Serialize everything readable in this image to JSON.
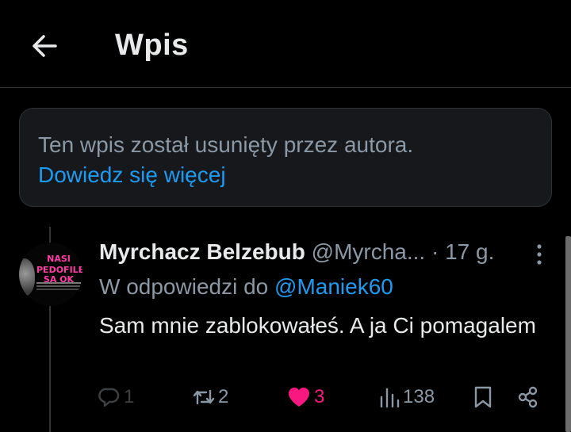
{
  "header": {
    "title": "Wpis",
    "back_icon": "arrow-left-icon"
  },
  "deleted_notice": {
    "text": "Ten wpis został usunięty przez autora.",
    "link": "Dowiedz się więcej"
  },
  "post": {
    "avatar_text_line1": "NASI",
    "avatar_text_line2": "PEDOFILE SĄ OK",
    "author_name": "Myrchacz Belzebub",
    "handle": "@Myrcha...",
    "time": "· 17 g.",
    "reply_prefix": "W odpowiedzi do ",
    "reply_to": "@Maniek60",
    "text": "Sam mnie zablokowałeś. A ja Ci pomagalem",
    "actions": {
      "replies": "1",
      "reposts": "2",
      "likes": "3",
      "views": "138"
    }
  },
  "colors": {
    "accent": "#1d9bf0",
    "like": "#f91880",
    "muted": "#8b98a5",
    "background": "#000000"
  }
}
